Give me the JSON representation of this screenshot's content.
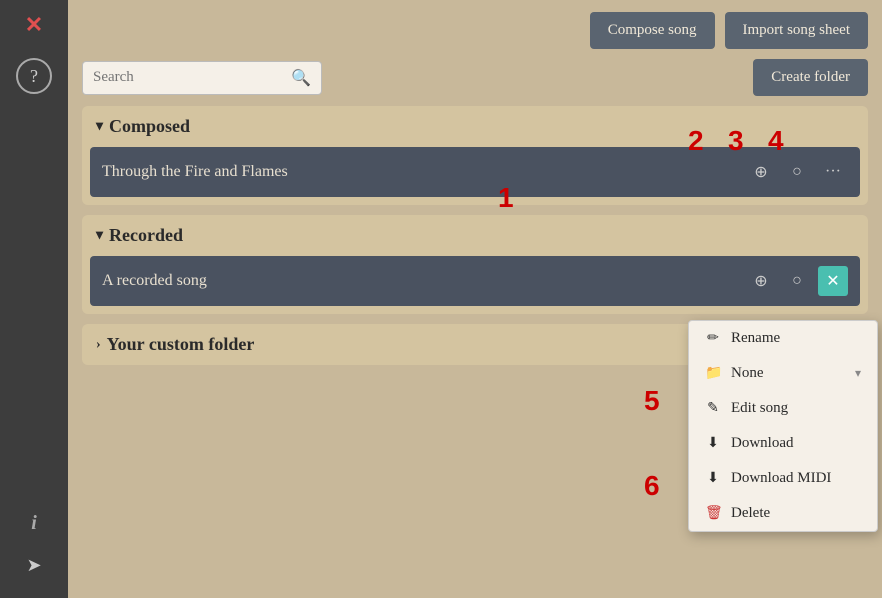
{
  "sidebar": {
    "close_icon": "✕",
    "help_icon": "?",
    "info_icon": "i",
    "arrow_icon": "➤"
  },
  "toolbar": {
    "compose_label": "Compose song",
    "import_label": "Import song sheet"
  },
  "search": {
    "placeholder": "Search",
    "create_folder_label": "Create folder"
  },
  "sections": [
    {
      "id": "composed",
      "label": "Composed",
      "expanded": true,
      "chevron": "▾",
      "songs": [
        {
          "title": "Through the Fire and Flames"
        }
      ]
    },
    {
      "id": "recorded",
      "label": "Recorded",
      "expanded": true,
      "chevron": "▾",
      "songs": [
        {
          "title": "A recorded song"
        }
      ]
    },
    {
      "id": "custom",
      "label": "Your custom folder",
      "expanded": false,
      "chevron": "›",
      "songs": []
    }
  ],
  "context_menu": {
    "items": [
      {
        "id": "rename",
        "icon": "✏",
        "label": "Rename",
        "has_sub": false
      },
      {
        "id": "none",
        "icon": "📁",
        "label": "None",
        "has_sub": true
      },
      {
        "id": "edit",
        "icon": "✎",
        "label": "Edit song",
        "has_sub": false
      },
      {
        "id": "download",
        "icon": "⬇",
        "label": "Download",
        "has_sub": false
      },
      {
        "id": "download-midi",
        "icon": "⬇",
        "label": "Download MIDI",
        "has_sub": false
      },
      {
        "id": "delete",
        "icon": "🗑",
        "label": "Delete",
        "has_sub": false,
        "danger": true
      }
    ]
  },
  "annotations": {
    "n1": "1",
    "n2": "2",
    "n3": "3",
    "n4": "4",
    "n5": "5",
    "n6": "6"
  }
}
